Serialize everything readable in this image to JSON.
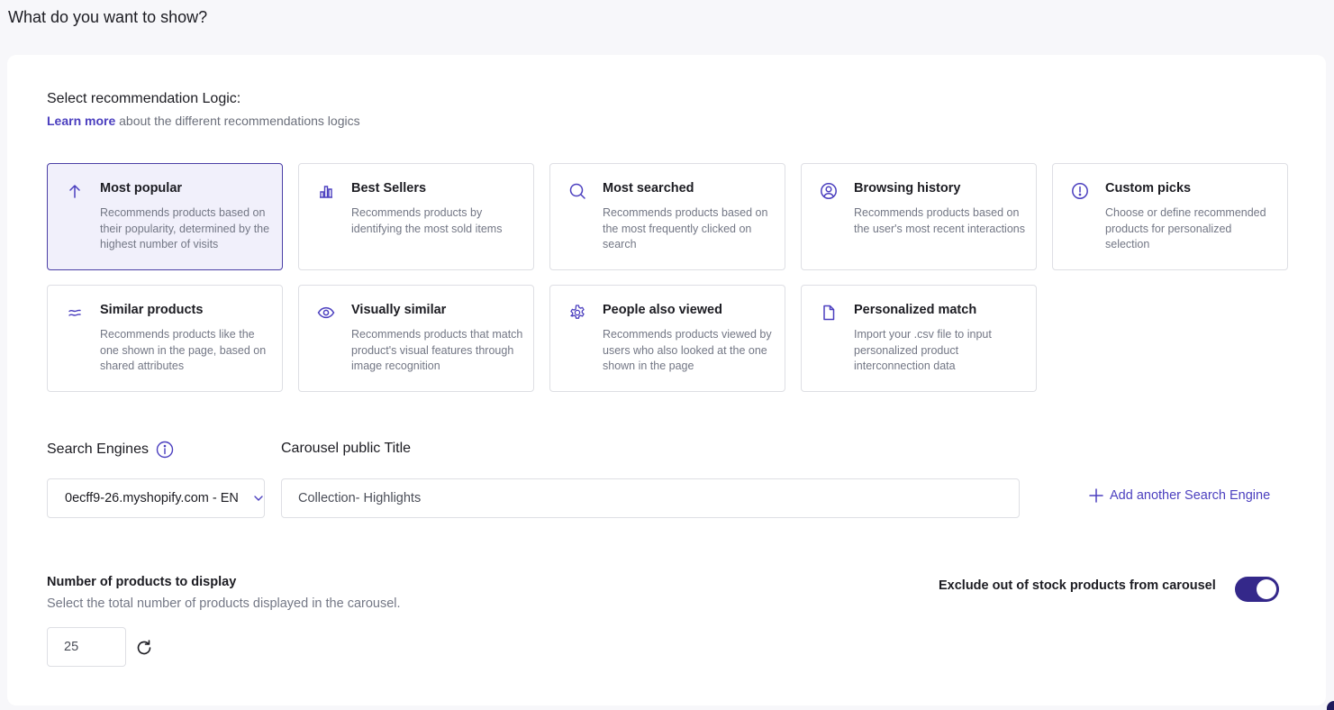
{
  "page": {
    "title": "What do you want to show?"
  },
  "logic": {
    "title": "Select recommendation Logic:",
    "learn_more_link": "Learn more",
    "learn_more_suffix": " about the different recommendations logics",
    "selected": "most-popular",
    "cards": [
      {
        "id": "most-popular",
        "icon": "arrow-up-icon",
        "title": "Most popular",
        "desc": "Recommends products based on their popularity, determined by the highest number of visits"
      },
      {
        "id": "best-sellers",
        "icon": "bar-chart-icon",
        "title": "Best Sellers",
        "desc": "Recommends products by identifying the most sold items"
      },
      {
        "id": "most-searched",
        "icon": "search-icon",
        "title": "Most searched",
        "desc": "Recommends products based on the most frequently clicked on search"
      },
      {
        "id": "browsing-history",
        "icon": "user-circle-icon",
        "title": "Browsing history",
        "desc": "Recommends products based on the user's most recent interactions"
      },
      {
        "id": "custom-picks",
        "icon": "exclamation-circle-icon",
        "title": "Custom picks",
        "desc": "Choose or define recommended products for personalized selection"
      },
      {
        "id": "similar-products",
        "icon": "approx-icon",
        "title": "Similar products",
        "desc": "Recommends products like the one shown in the page, based on shared attributes"
      },
      {
        "id": "visually-similar",
        "icon": "eye-icon",
        "title": "Visually similar",
        "desc": "Recommends products that match product's visual features through image recognition"
      },
      {
        "id": "people-also-viewed",
        "icon": "gear-icon",
        "title": "People also viewed",
        "desc": "Recommends products viewed by users who also looked at the one shown in the page"
      },
      {
        "id": "personalized-match",
        "icon": "file-icon",
        "title": "Personalized match",
        "desc": "Import your .csv file to input personalized product interconnection data"
      }
    ]
  },
  "search_engines": {
    "label": "Search Engines",
    "selected_value": "0ecff9-26.myshopify.com - EN",
    "add_label": "Add another Search Engine"
  },
  "carousel_title": {
    "label": "Carousel public Title",
    "value": "Collection- Highlights"
  },
  "num_products": {
    "title": "Number of products to display",
    "desc": "Select the total number of products displayed in the carousel.",
    "value": "25"
  },
  "exclude_oos": {
    "label": "Exclude out of stock products from carousel",
    "enabled": true
  },
  "colors": {
    "accent": "#4b3fbf",
    "toggle_on": "#34288a",
    "selected_card_bg": "#f1f0fb"
  }
}
